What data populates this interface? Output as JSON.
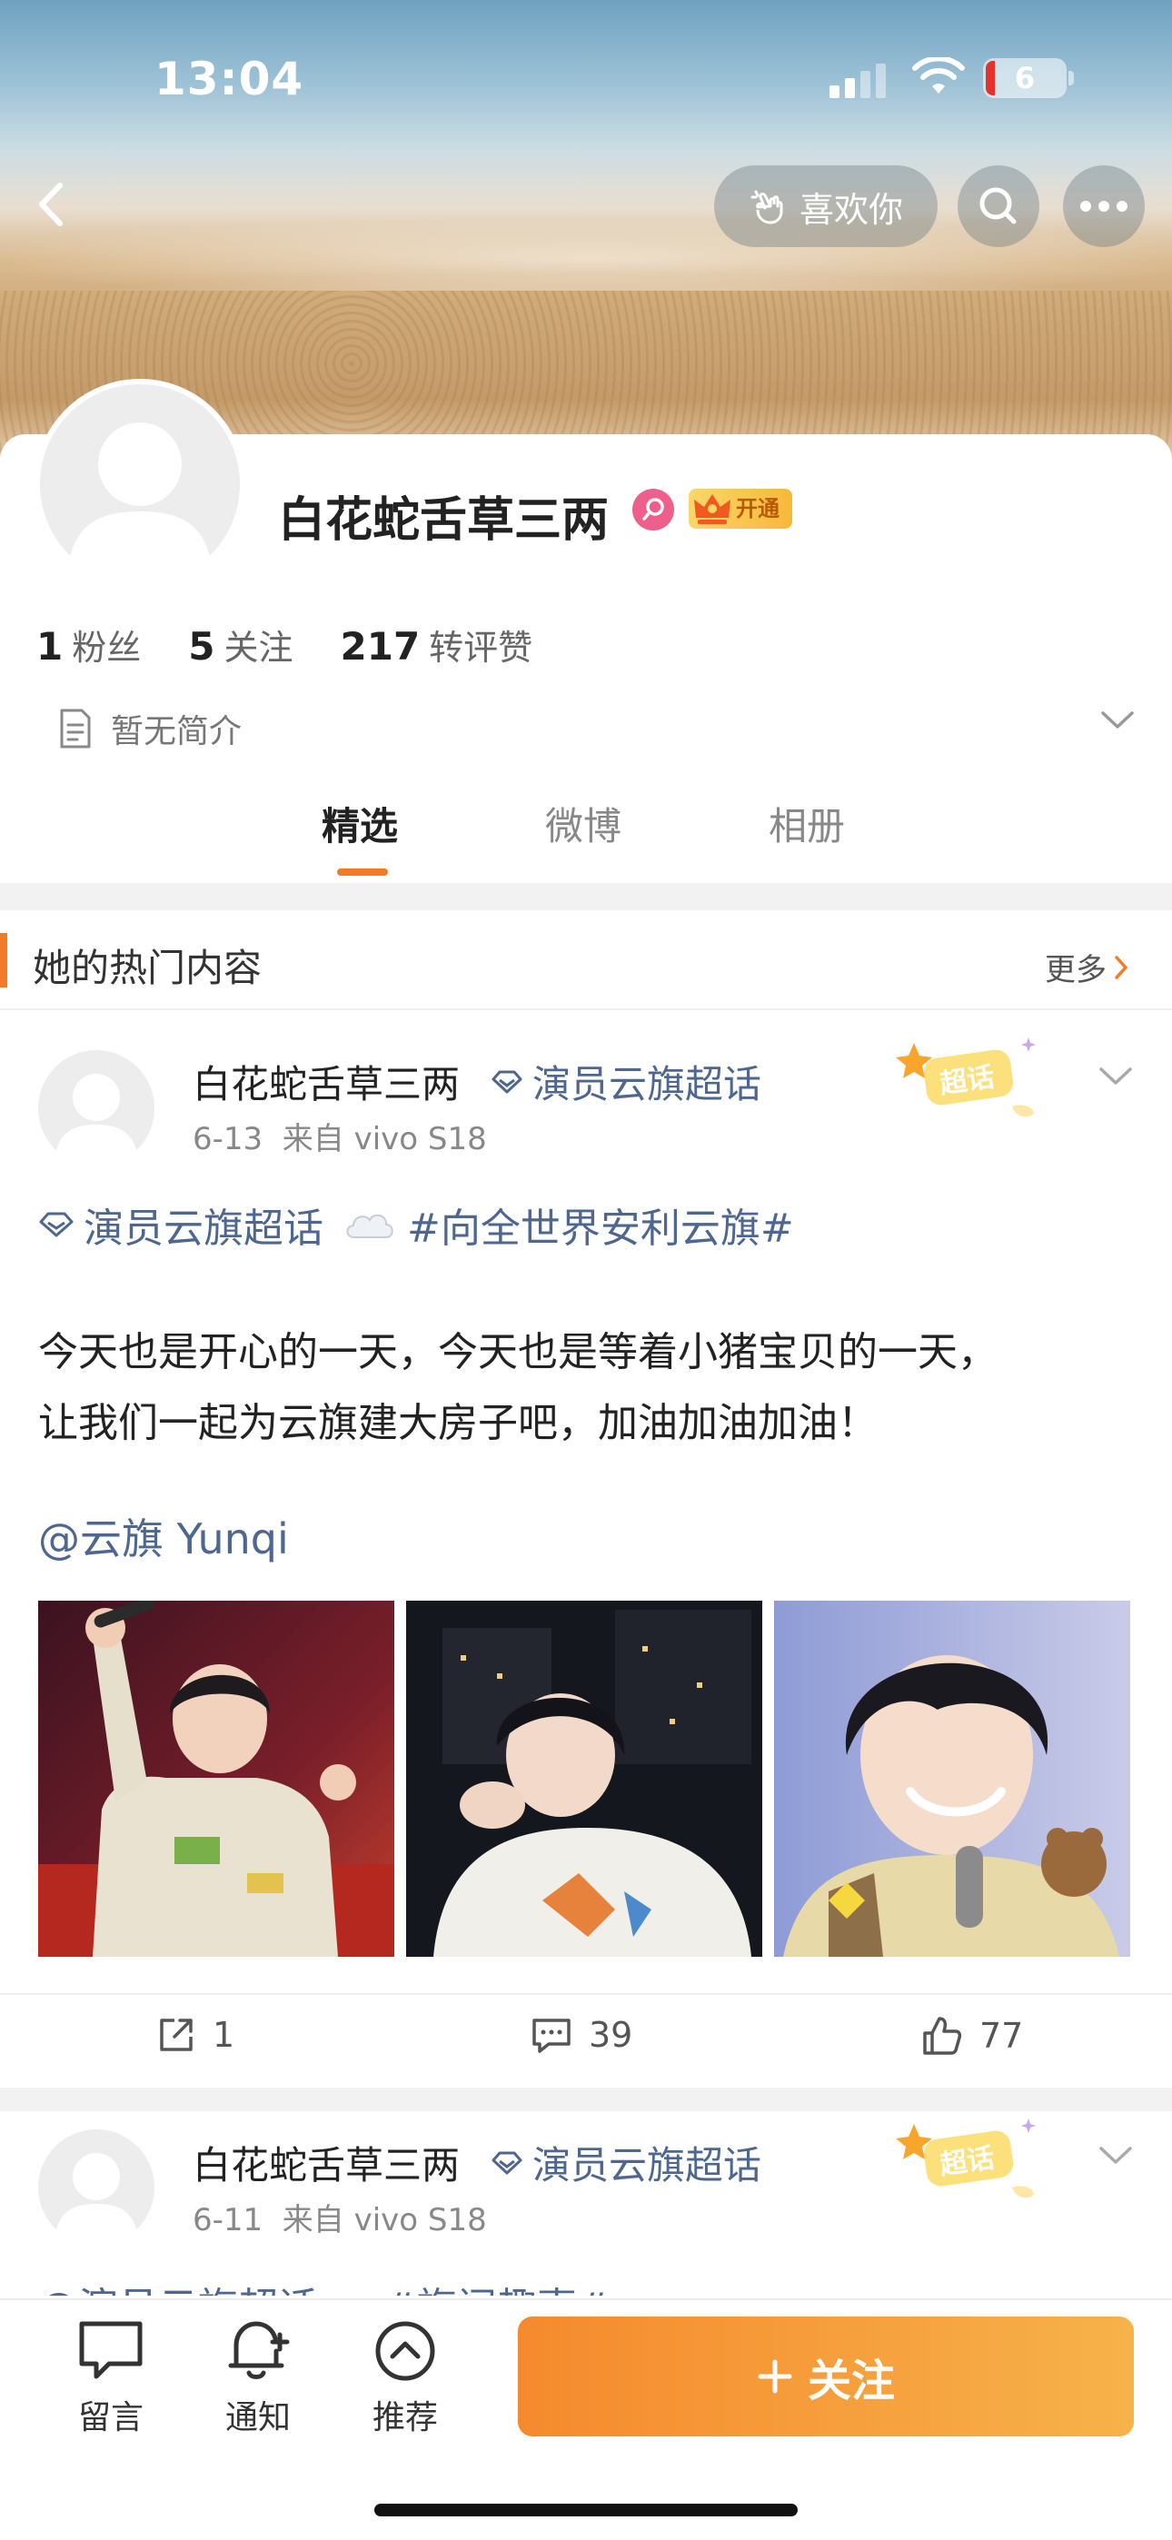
{
  "status_bar": {
    "time": "13:04",
    "battery": "6"
  },
  "header": {
    "like_label": "喜欢你"
  },
  "profile": {
    "name": "白花蛇舌草三两",
    "vip_label": "开通",
    "stats": [
      {
        "num": "1",
        "label": "粉丝"
      },
      {
        "num": "5",
        "label": "关注"
      },
      {
        "num": "217",
        "label": "转评赞"
      }
    ],
    "bio": "暂无简介"
  },
  "tabs": [
    "精选",
    "微博",
    "相册"
  ],
  "hot": {
    "title": "她的热门内容",
    "more": "更多"
  },
  "posts": [
    {
      "author": "白花蛇舌草三两",
      "topic": "演员云旗超话",
      "badge": "超话",
      "date": "6-13",
      "source": "来自 vivo S18",
      "hashtag_topic": "演员云旗超话",
      "hashtag": "#向全世界安利云旗#",
      "text_line1": "今天也是开心的一天，今天也是等着小猪宝贝的一天，",
      "text_line2": "让我们一起为云旗建大房子吧，加油加油加油！",
      "mention": "@云旗 Yunqi",
      "reposts": "1",
      "comments": "39",
      "likes": "77"
    },
    {
      "author": "白花蛇舌草三两",
      "topic": "演员云旗超话",
      "badge": "超话",
      "date": "6-11",
      "source": "来自 vivo S18",
      "peek": "@演员云旗超话 ☁ #旗闻趣事#"
    }
  ],
  "bottom_bar": {
    "message": "留言",
    "notify": "通知",
    "recommend": "推荐",
    "follow": "关注"
  },
  "colors": {
    "accent": "#f37a26",
    "link": "#4d6790",
    "follow_gradient_start": "#f58a2d",
    "follow_gradient_end": "#f7b24a"
  }
}
